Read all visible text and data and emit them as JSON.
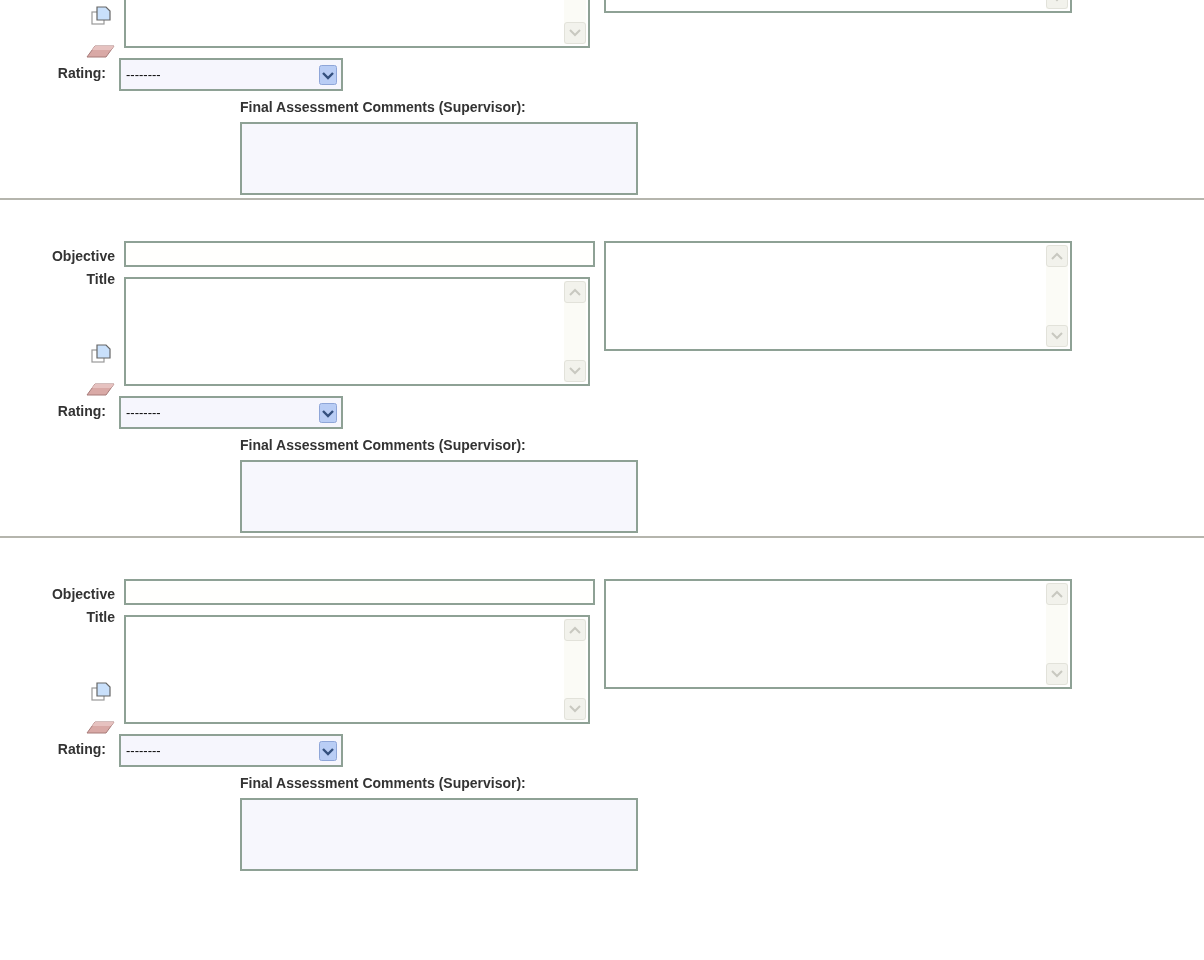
{
  "sections": [
    {
      "rating": {
        "label": "Rating:",
        "value": "--------"
      },
      "comments_label": "Final Assessment Comments (Supervisor):"
    },
    {
      "objective_label": "Objective Title",
      "rating": {
        "label": "Rating:",
        "value": "--------"
      },
      "comments_label": "Final Assessment Comments (Supervisor):"
    },
    {
      "objective_label": "Objective Title",
      "rating": {
        "label": "Rating:",
        "value": "--------"
      },
      "comments_label": "Final Assessment Comments (Supervisor):"
    }
  ]
}
